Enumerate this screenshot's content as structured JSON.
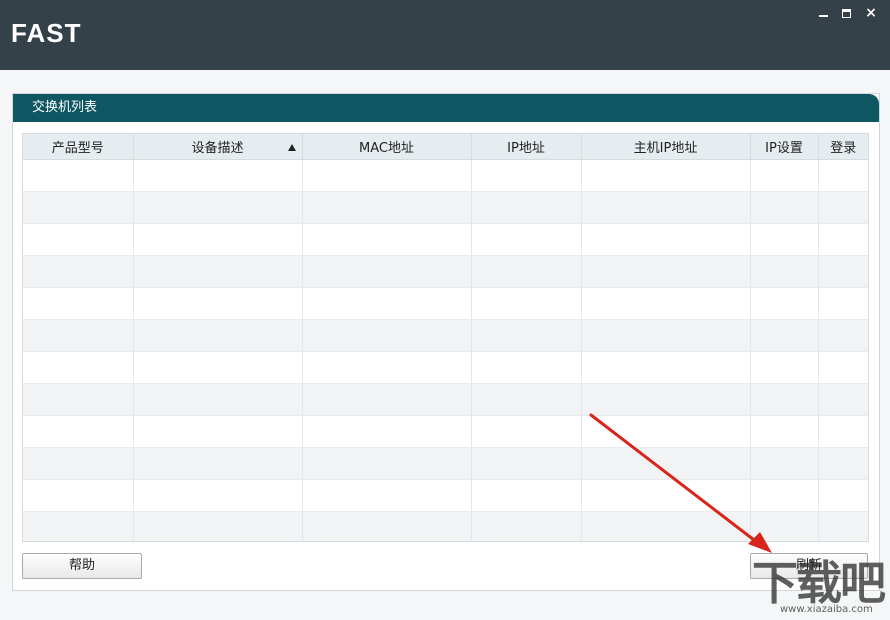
{
  "window": {
    "logo": "FAST",
    "minimize": "minimize",
    "maximize": "maximize",
    "close": "×"
  },
  "panel": {
    "title": "交换机列表"
  },
  "table": {
    "columns": [
      {
        "label": "产品型号"
      },
      {
        "label": "设备描述",
        "sorted": "ascending"
      },
      {
        "label": "MAC地址"
      },
      {
        "label": "IP地址"
      },
      {
        "label": "主机IP地址"
      },
      {
        "label": "IP设置"
      },
      {
        "label": "登录"
      }
    ],
    "row_count": 12,
    "rows": []
  },
  "buttons": {
    "help": "帮助",
    "refresh": "刷新"
  },
  "watermark": {
    "big": "下载吧",
    "small": "www.xiazaiba.com"
  },
  "colors": {
    "titlebar": "#344148",
    "panel_header": "#0f5663",
    "annotation_arrow": "#d9241c"
  }
}
